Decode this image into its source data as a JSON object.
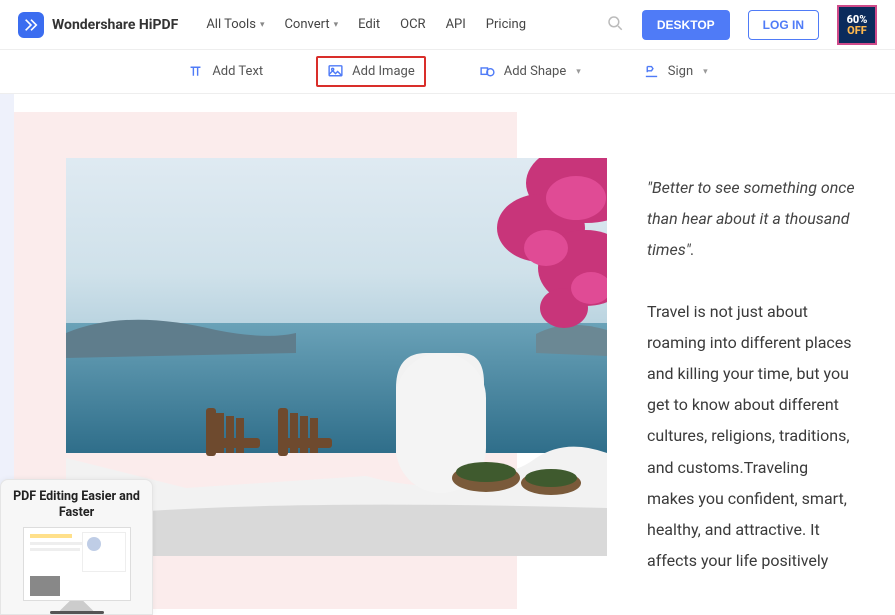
{
  "brand": {
    "name": "Wondershare HiPDF"
  },
  "nav": {
    "all_tools": "All Tools",
    "convert": "Convert",
    "edit": "Edit",
    "ocr": "OCR",
    "api": "API",
    "pricing": "Pricing"
  },
  "cta": {
    "desktop": "DESKTOP",
    "login": "LOG IN"
  },
  "promo": {
    "line1": "60%",
    "line2": "OFF"
  },
  "toolbar": {
    "add_text": "Add Text",
    "add_image": "Add Image",
    "add_shape": "Add Shape",
    "sign": "Sign"
  },
  "document": {
    "quote": "\"Better to see something once than hear about it a thousand times\".",
    "body": "Travel is not just about roaming into different places and killing your time, but you get to know about different cultures, religions, traditions, and customs.Traveling makes you confident, smart, healthy, and attractive. It affects your life positively"
  },
  "float_promo": {
    "title": "PDF Editing Easier and Faster"
  }
}
